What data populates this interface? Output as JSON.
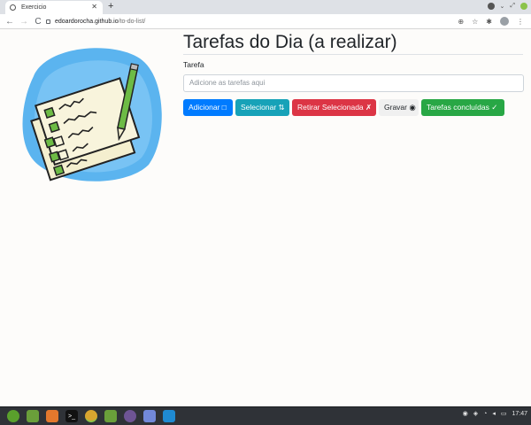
{
  "browser": {
    "tab_title": "Exercicio",
    "new_tab_symbol": "+",
    "url_host": "edoardorocha.github.io",
    "url_path": "/to-do-list/",
    "back_symbol": "←",
    "forward_symbol": "→",
    "reload_symbol": "C"
  },
  "page": {
    "title": "Tarefas do Dia (a realizar)",
    "task_label": "Tarefa",
    "task_input_value": "",
    "task_input_placeholder": "Adicione as tarefas aqui",
    "buttons": {
      "add": "Adicionar □",
      "select": "Selecionar ⇅",
      "remove": "Retirar Selecionada ✗",
      "save": "Gravar ◉",
      "done": "Tarefas concluídas ✓"
    }
  },
  "taskbar": {
    "clock": "17:47"
  },
  "colors": {
    "primary": "#007bff",
    "info": "#17a2b8",
    "danger": "#dc3545",
    "success": "#28a745",
    "light": "#f0f0f0",
    "taskbar": "#2f3237"
  }
}
